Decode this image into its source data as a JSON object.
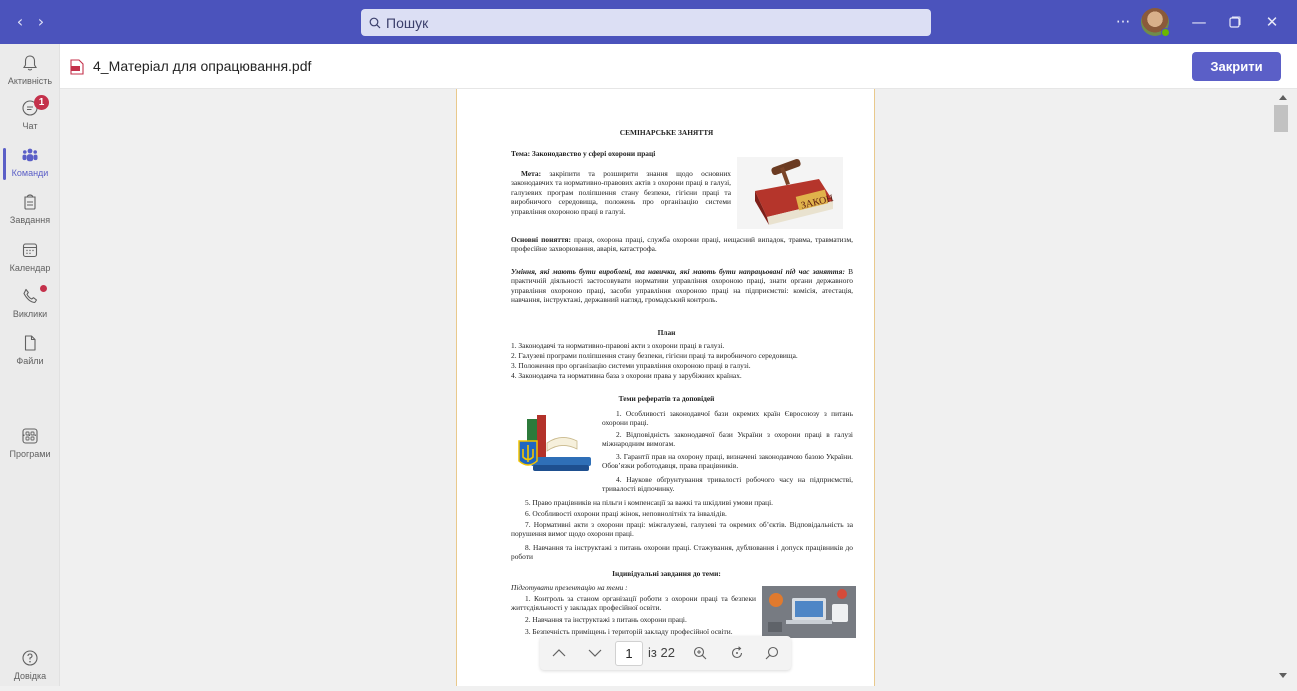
{
  "titlebar": {
    "search_placeholder": "Пошук",
    "more_label": "···",
    "accent": "#4b53bc"
  },
  "rail": {
    "items": [
      {
        "label": "Активність",
        "icon": "bell-icon"
      },
      {
        "label": "Чат",
        "icon": "chat-icon",
        "badge": "1"
      },
      {
        "label": "Команди",
        "icon": "teams-icon",
        "active": true
      },
      {
        "label": "Завдання",
        "icon": "assignments-icon"
      },
      {
        "label": "Календар",
        "icon": "calendar-icon"
      },
      {
        "label": "Виклики",
        "icon": "phone-icon"
      },
      {
        "label": "Файли",
        "icon": "file-icon"
      },
      {
        "label": "Програми",
        "icon": "apps-icon"
      },
      {
        "label": "Довідка",
        "icon": "help-icon"
      }
    ],
    "more": "···"
  },
  "file": {
    "name": "4_Матеріал для опрацювання.pdf",
    "close_label": "Закрити"
  },
  "document": {
    "title": "СЕМІНАРСЬКЕ ЗАНЯТТЯ",
    "topic": "Тема: Законодавство у сфері охорони праці",
    "goal_label": "Мета:",
    "goal_text": "закріпити та розширити знання щодо основних законодавчих та нормативно-правових актів з охорони праці в галузі, галузевих програм поліпшення стану безпеки, гігієни праці та виробничого середовища, положень про організацію системи управління охороною праці в галузі.",
    "concepts_label": "Основні поняття:",
    "concepts_text": "праця, охорона праці, служба охорони праці, нещасний випадок, травма, травматизм, професійне захворювання, аварія, катастрофа.",
    "skills_label": "Уміння, які мають бути вироблені, та навички, які мають бути напрацьовані під час заняття:",
    "skills_text": "В практичній діяльності застосовувати нормативи управління охороною праці, знати органи державного управління охороною праці, засоби управління охороною праці на підприємстві: комісія, атестація, навчання, інструктажі, державний нагляд, громадський контроль.",
    "plan_title": "План",
    "plan_items": [
      "1. Законодавчі та нормативно-правові акти з охорони праці в галузі.",
      "2. Галузеві програми поліпшення стану безпеки, гігієни праці та виробничого середовища.",
      "3. Положення про організацію системи управління охороною праці в галузі.",
      "4. Законодавча та нормативна база з охорони права у зарубіжних країнах."
    ],
    "reports_title": "Теми рефератів та доповідей",
    "report_items": [
      "1. Особливості законодавчої бази окремих країн Євросоюзу з питань охорони праці.",
      "2. Відповідність законодавчої бази України з охорони праці в галузі міжнародним вимогам.",
      "3. Гарантії прав на охорону праці, визначені законодавчою базою України. Обов’язки роботодавця, права працівників.",
      "4. Наукове обґрунтування тривалості робочого часу на підприємстві, тривалості відпочинку.",
      "5. Право працівників на пільги і компенсації за важкі та шкідливі умови праці.",
      "6. Особливості охорони праці жінок, неповнолітніх та інвалідів.",
      "7. Нормативні акти з охорони праці: міжгалузеві, галузеві та окремих об’єктів. Відповідальність за порушення вимог щодо охорони праці.",
      "8. Навчання та інструктажі з питань охорони праці. Стажування, дублювання і допуск працівників до роботи"
    ],
    "individual_title": "Індивідуальні завдання до теми:",
    "individual_subtitle": "Підготувати презентацію на теми :",
    "individual_items": [
      "1. Контроль за станом організації роботи з охорони праці та безпеки життєдіяльності у закладах професійної освіти.",
      "2. Навчання та інструктажі з питань охорони праці.",
      "3. Безпечність приміщень і територій закладу професійної освіти."
    ],
    "law_book_text": "ЗАКОН"
  },
  "pdf_toolbar": {
    "current_page": "1",
    "total_label": "із 22"
  }
}
